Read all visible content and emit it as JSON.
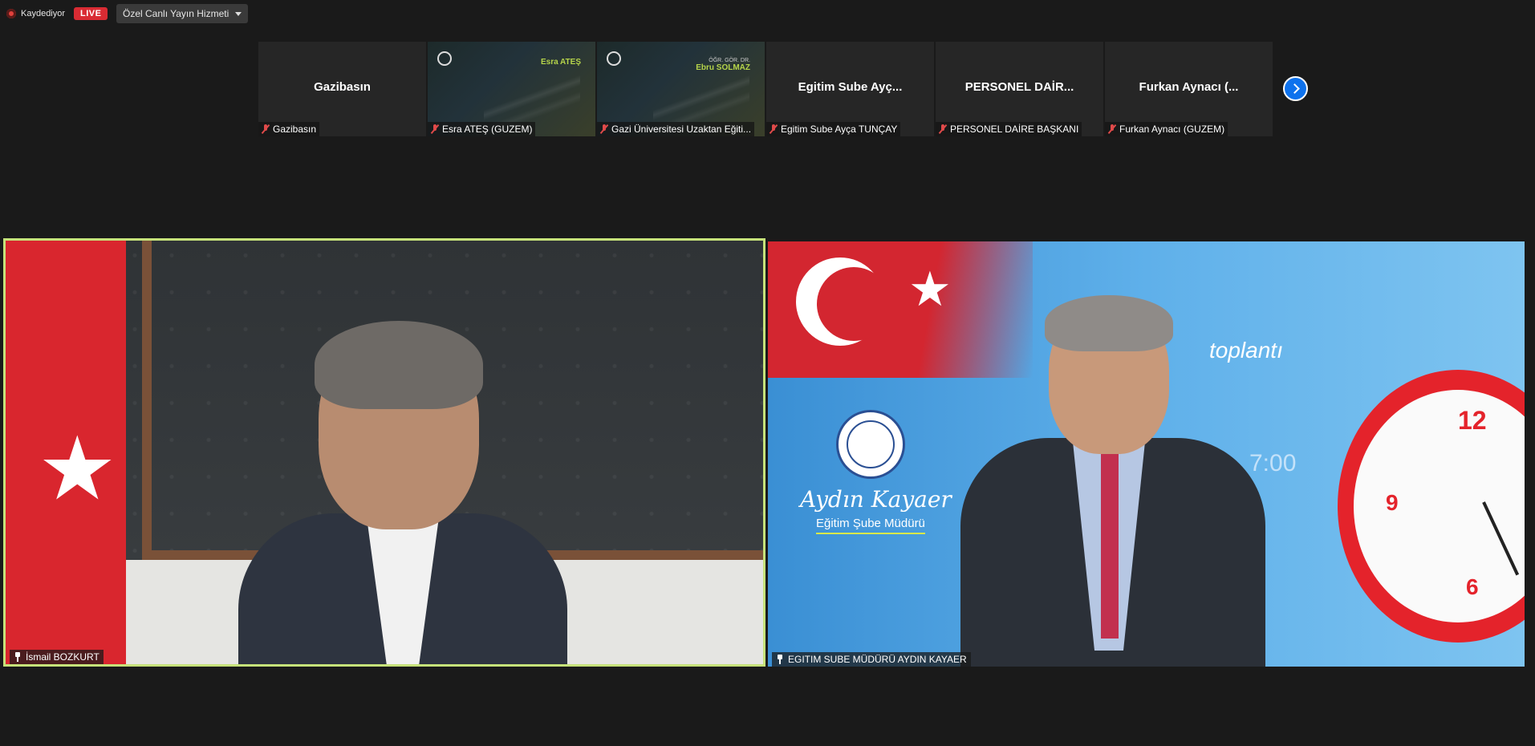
{
  "topbar": {
    "recording_label": "Kaydediyor",
    "live_badge": "LIVE",
    "stream_service": "Özel Canlı Yayın Hizmeti"
  },
  "strip": {
    "tiles": [
      {
        "center_name": "Gazibasın",
        "label": "Gazibasın",
        "has_video": false
      },
      {
        "center_name": "",
        "label": "Esra ATEŞ (GUZEM)",
        "has_video": true,
        "overlay_name": "Esra ATEŞ",
        "overlay_title": ""
      },
      {
        "center_name": "",
        "label": "Gazi Üniversitesi Uzaktan Eğiti...",
        "has_video": true,
        "overlay_name": "Ebru SOLMAZ",
        "overlay_title": "ÖĞR. GÖR. DR."
      },
      {
        "center_name": "Egitim Sube Ayç...",
        "label": "Egitim Sube Ayça TUNÇAY",
        "has_video": false
      },
      {
        "center_name": "PERSONEL DAİR...",
        "label": "PERSONEL DAİRE BAŞKANI",
        "has_video": false
      },
      {
        "center_name": "Furkan Aynacı (...",
        "label": "Furkan Aynacı (GUZEM)",
        "has_video": false
      }
    ]
  },
  "videos": {
    "left": {
      "name": "İsmail BOZKURT",
      "active_speaker": true
    },
    "right": {
      "name": "EGITIM SUBE MÜDÜRÜ AYDIN KAYAER",
      "bg_signature": "Aydın Kayaer",
      "bg_role": "Eğitim Şube Müdürü",
      "bg_word": "toplantı",
      "bg_time": "7:00",
      "clock_12": "12",
      "clock_9": "9",
      "clock_6": "6"
    }
  },
  "colors": {
    "live_red": "#d92b33",
    "active_border": "#c6e27a",
    "next_button_blue": "#0e72ed"
  }
}
